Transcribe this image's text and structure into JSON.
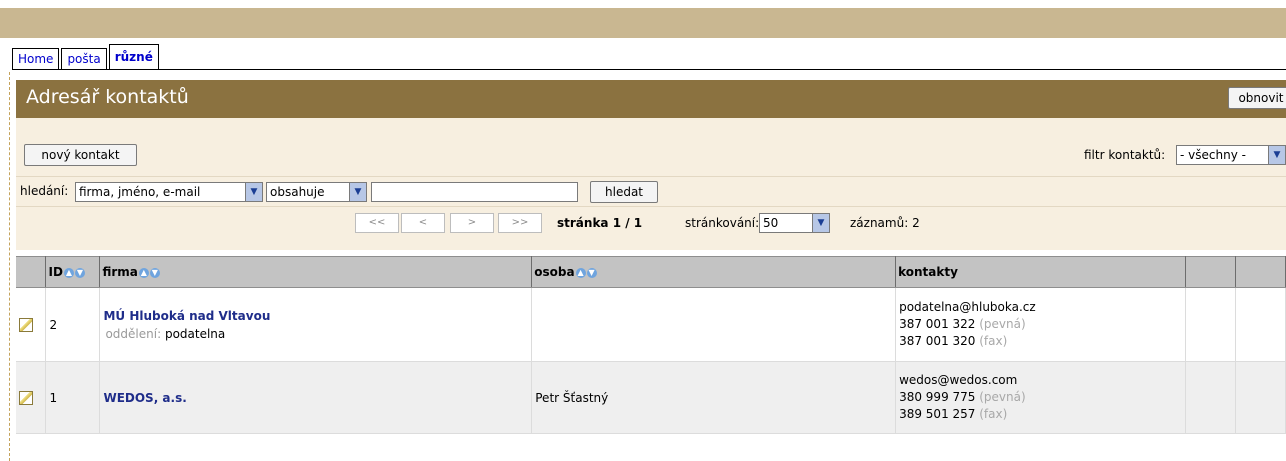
{
  "tabs": [
    {
      "label": "Home"
    },
    {
      "label": "pošta"
    },
    {
      "label": "různé"
    }
  ],
  "page": {
    "title": "Adresář kontaktů",
    "refresh_label": "obnovit"
  },
  "toolbar": {
    "new_contact_label": "nový kontakt",
    "filter_label": "filtr kontaktů:",
    "filter_value": "- všechny -"
  },
  "search": {
    "label": "hledání:",
    "field_value": "firma, jméno, e-mail",
    "operator_value": "obsahuje",
    "input_value": "",
    "button_label": "hledat"
  },
  "pagination": {
    "first": "<<",
    "prev": "<",
    "next": ">",
    "last": ">>",
    "page_text": "stránka 1 / 1",
    "per_page_label": "stránkování:",
    "per_page_value": "50",
    "records_text": "záznamů: 2"
  },
  "table": {
    "headers": {
      "id": "ID",
      "firma": "firma",
      "osoba": "osoba",
      "kontakty": "kontakty"
    },
    "rows": [
      {
        "id": "2",
        "firma": "MÚ Hluboká nad Vltavou",
        "dept_label": "oddělení:",
        "dept_value": "podatelna",
        "osoba": "",
        "email": "podatelna@hluboka.cz",
        "phone1": "387 001 322",
        "phone1_type": "(pevná)",
        "phone2": "387 001 320",
        "phone2_type": "(fax)"
      },
      {
        "id": "1",
        "firma": "WEDOS, a.s.",
        "osoba": "Petr Šťastný",
        "email": "wedos@wedos.com",
        "phone1": "380 999 775",
        "phone1_type": "(pevná)",
        "phone2": "389 501 257",
        "phone2_type": "(fax)"
      }
    ]
  },
  "colors": {
    "top_band": "#c9b791",
    "title_bar": "#8b7240",
    "panel_bg": "#f7efe0",
    "header_bg": "#c3c3c3",
    "link_firm": "#1f2d8a"
  }
}
